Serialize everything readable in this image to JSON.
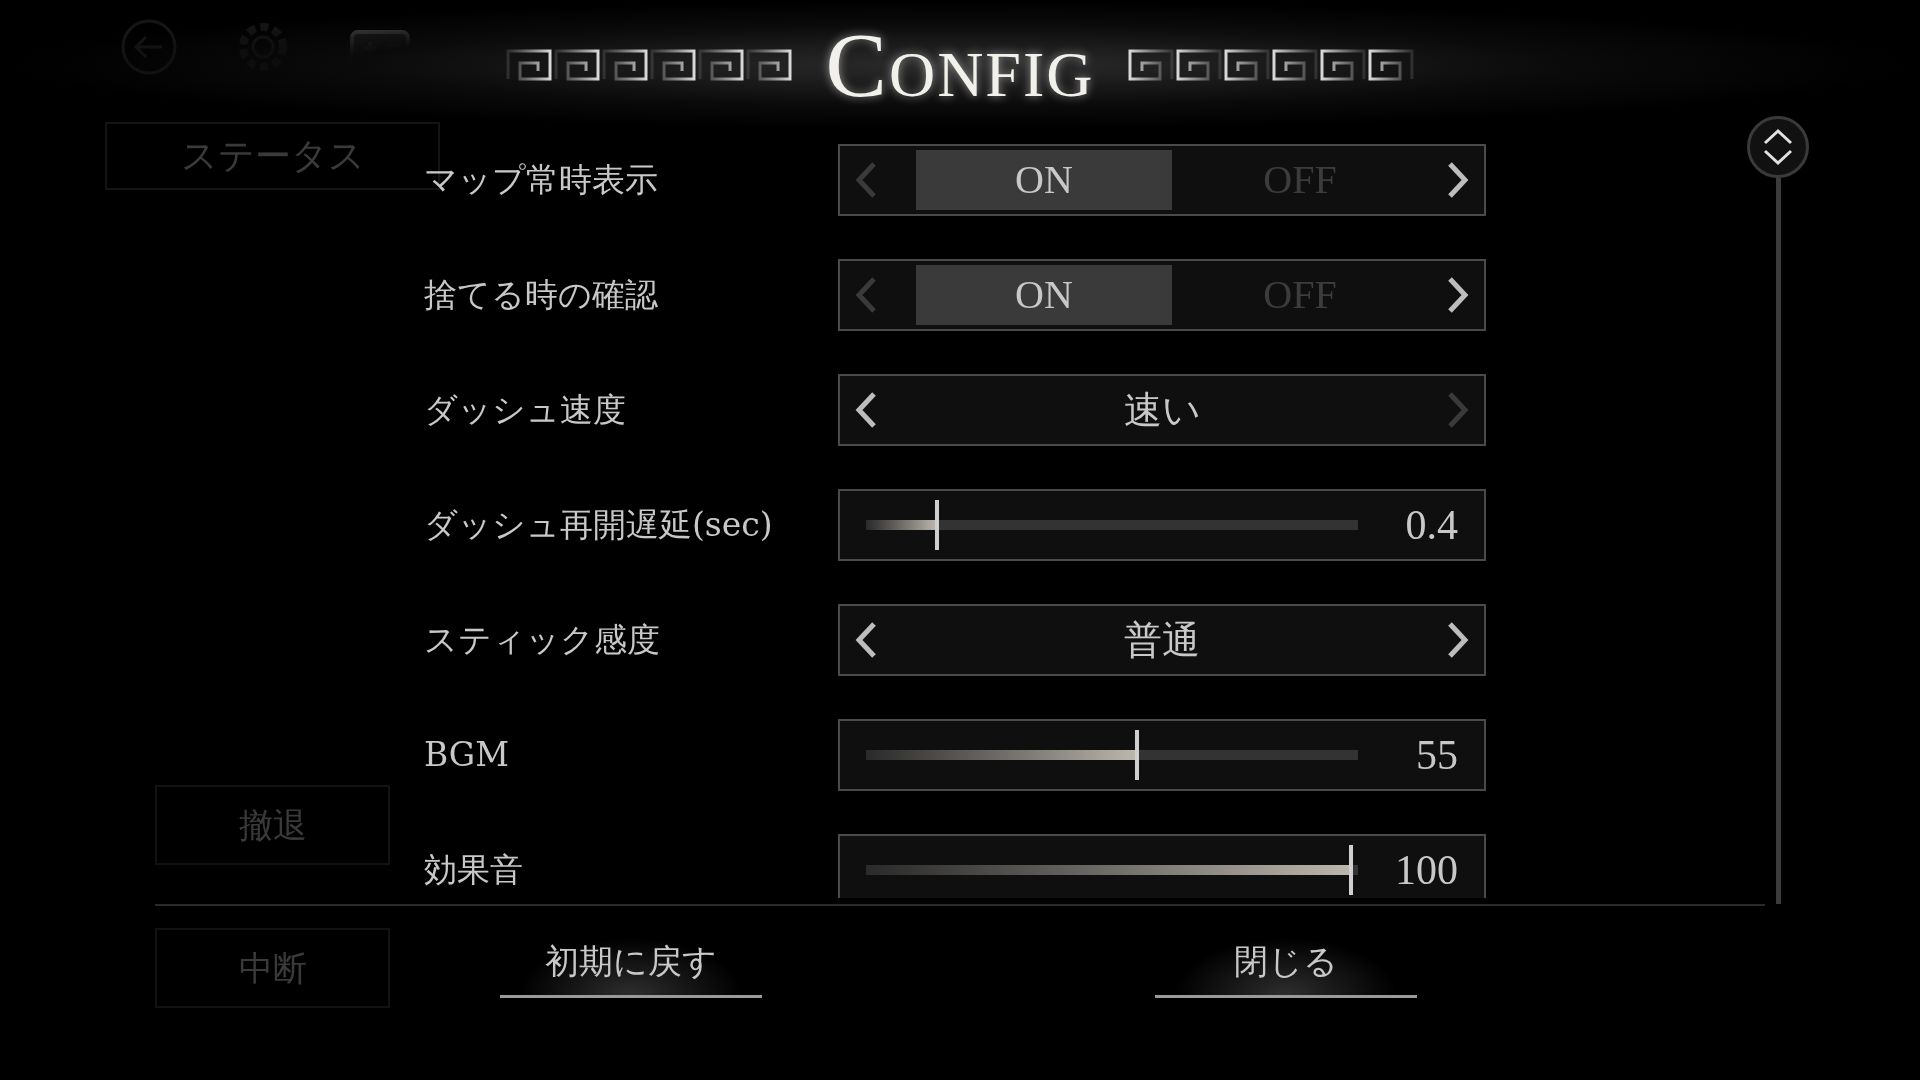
{
  "background_menu": {
    "status_tab": "ステータス",
    "retreat_button": "撤退",
    "suspend_button": "中断"
  },
  "title": "CONFIG",
  "settings": [
    {
      "kind": "toggle",
      "label": "マップ常時表示",
      "options": [
        {
          "label": "ON",
          "selected": true
        },
        {
          "label": "OFF",
          "selected": false
        }
      ],
      "prev_disabled": true,
      "next_disabled": false
    },
    {
      "kind": "toggle",
      "label": "捨てる時の確認",
      "options": [
        {
          "label": "ON",
          "selected": true
        },
        {
          "label": "OFF",
          "selected": false
        }
      ],
      "prev_disabled": true,
      "next_disabled": false
    },
    {
      "kind": "select",
      "label": "ダッシュ速度",
      "value": "速い",
      "prev_disabled": false,
      "next_disabled": true
    },
    {
      "kind": "slider",
      "label": "ダッシュ再開遅延(sec)",
      "level": 0.145,
      "reading": "0.4"
    },
    {
      "kind": "select",
      "label": "スティック感度",
      "value": "普通",
      "prev_disabled": false,
      "next_disabled": false
    },
    {
      "kind": "slider",
      "label": "BGM",
      "level": 0.55,
      "reading": "55"
    },
    {
      "kind": "slider",
      "label": "効果音",
      "level": 0.985,
      "reading": "100"
    }
  ],
  "buttons": [
    "初期に戻す",
    "閉じる"
  ]
}
